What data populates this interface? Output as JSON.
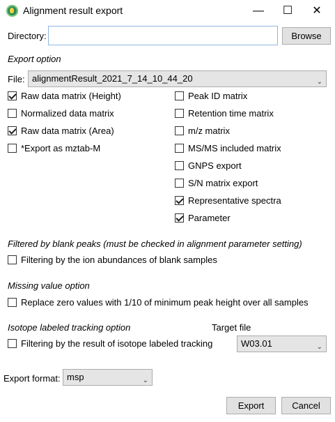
{
  "window": {
    "title": "Alignment result export",
    "controls": {
      "minimize": "—",
      "maximize": "☐",
      "close": "✕"
    }
  },
  "directory": {
    "label": "Directory:",
    "value": "",
    "browse_label": "Browse"
  },
  "export_option": {
    "heading": "Export option",
    "file_label": "File:",
    "file_value": "alignmentResult_2021_7_14_10_44_20",
    "left_checks": [
      {
        "label": "Raw data matrix (Height)",
        "checked": true
      },
      {
        "label": "Normalized data matrix",
        "checked": false
      },
      {
        "label": "Raw data matrix (Area)",
        "checked": true
      },
      {
        "label": "*Export as mztab-M",
        "checked": false
      }
    ],
    "right_checks": [
      {
        "label": "Peak ID matrix",
        "checked": false
      },
      {
        "label": "Retention time matrix",
        "checked": false
      },
      {
        "label": "m/z matrix",
        "checked": false
      },
      {
        "label": "MS/MS included matrix",
        "checked": false
      },
      {
        "label": "GNPS export",
        "checked": false
      },
      {
        "label": "S/N matrix export",
        "checked": false
      },
      {
        "label": "Representative spectra",
        "checked": true
      },
      {
        "label": "Parameter",
        "checked": true
      }
    ]
  },
  "blank_filter": {
    "heading": "Filtered by blank peaks (must be checked in alignment parameter setting)",
    "check_label": "Filtering by the ion abundances of blank samples",
    "checked": false
  },
  "missing_value": {
    "heading": "Missing value option",
    "check_label": "Replace zero values with 1/10 of minimum peak height over all samples",
    "checked": false
  },
  "isotope": {
    "heading": "Isotope labeled tracking option",
    "target_label": "Target file",
    "check_label": "Filtering by the result of isotope labeled tracking",
    "checked": false,
    "target_value": "W03.01"
  },
  "export_format": {
    "label": "Export format:",
    "value": "msp"
  },
  "footer": {
    "export_label": "Export",
    "cancel_label": "Cancel"
  },
  "icons": {
    "chevron": "⌄"
  }
}
